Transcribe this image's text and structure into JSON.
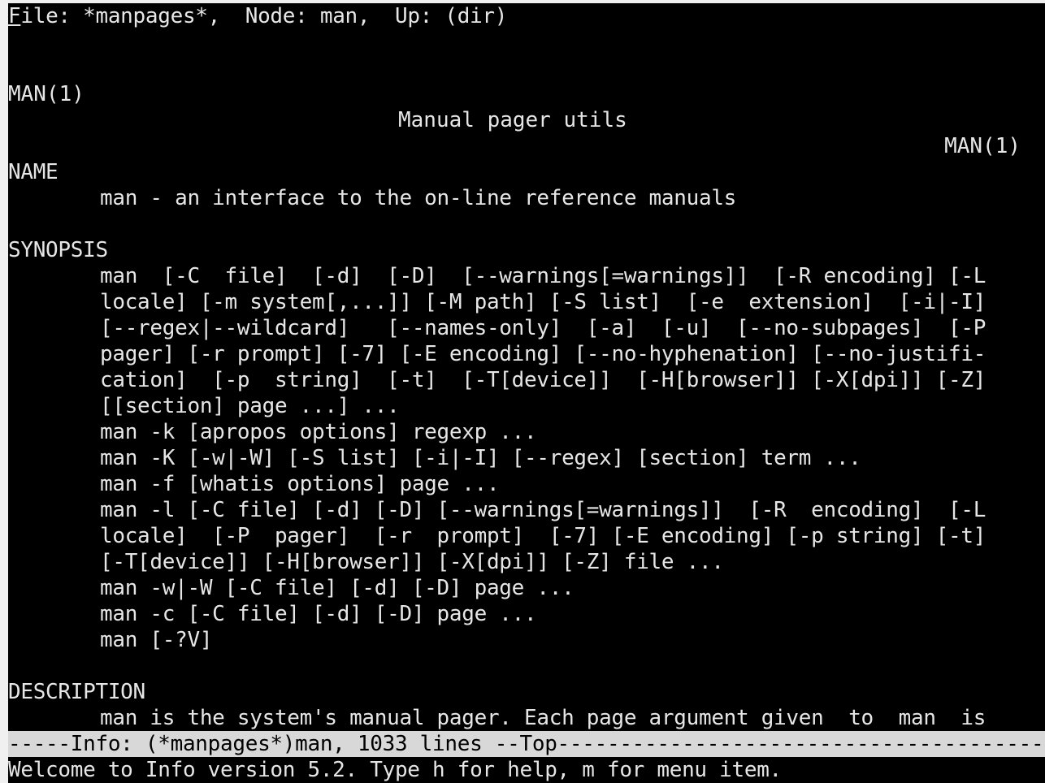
{
  "header_line": "File: *manpages*,  Node: man,  Up: (dir)",
  "man_header": {
    "left": "MAN(1)",
    "center": "Manual pager utils",
    "right": "MAN(1)"
  },
  "sections": {
    "name_heading": "NAME",
    "name_text": "man - an interface to the on-line reference manuals",
    "synopsis_heading": "SYNOPSIS",
    "synopsis_lines": [
      "man  [-C  file]  [-d]  [-D]  [--warnings[=warnings]]  [-R encoding] [-L",
      "locale] [-m system[,...]] [-M path] [-S list]  [-e  extension]  [-i|-I]",
      "[--regex|--wildcard]   [--names-only]  [-a]  [-u]  [--no-subpages]  [-P",
      "pager] [-r prompt] [-7] [-E encoding] [--no-hyphenation] [--no-justifi-",
      "cation]  [-p  string]  [-t]  [-T[device]]  [-H[browser]] [-X[dpi]] [-Z]",
      "[[section] page ...] ...",
      "man -k [apropos options] regexp ...",
      "man -K [-w|-W] [-S list] [-i|-I] [--regex] [section] term ...",
      "man -f [whatis options] page ...",
      "man -l [-C file] [-d] [-D] [--warnings[=warnings]]  [-R  encoding]  [-L",
      "locale]  [-P  pager]  [-r  prompt]  [-7] [-E encoding] [-p string] [-t]",
      "[-T[device]] [-H[browser]] [-X[dpi]] [-Z] file ...",
      "man -w|-W [-C file] [-d] [-D] page ...",
      "man -c [-C file] [-d] [-D] page ...",
      "man [-?V]"
    ],
    "description_heading": "DESCRIPTION",
    "description_text": "man is the system's manual pager. Each page argument given  to  man  is"
  },
  "mode_line": "-----Info: (*manpages*)man, 1033 lines --Top-----------------------------------------",
  "echo_area": "Welcome to Info version 5.2. Type h for help, m for menu item.",
  "colors": {
    "background": "#000000",
    "foreground": "#e6e6e6",
    "mode_line_bg": "#d8d8d8",
    "mode_line_fg": "#000000"
  }
}
